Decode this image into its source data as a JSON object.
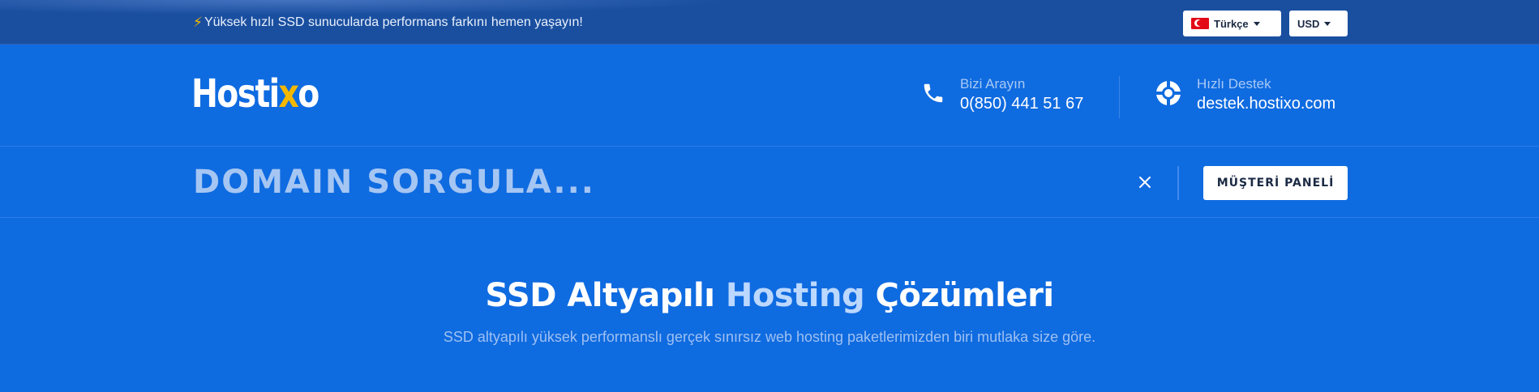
{
  "topbar": {
    "promo_icon": "lightning-icon",
    "promo_text": "Yüksek hızlı SSD sunucularda performans farkını hemen yaşayın!",
    "language": {
      "flag": "turkey-flag",
      "label": "Türkçe"
    },
    "currency": {
      "label": "USD"
    }
  },
  "header": {
    "logo_text_pre": "Hosti",
    "logo_text_x": "x",
    "logo_text_post": "o",
    "phone": {
      "icon": "phone-icon",
      "label": "Bizi Arayın",
      "value": "0(850) 441 51 67"
    },
    "support": {
      "icon": "lifebuoy-icon",
      "label": "Hızlı Destek",
      "value": "destek.hostixo.com"
    }
  },
  "domain_search": {
    "placeholder": "DOMAIN SORGULA...",
    "close_icon": "close-icon",
    "panel_button": "MÜŞTERİ PANELİ"
  },
  "hero": {
    "title_part1": "SSD Altyapılı ",
    "title_accent": "Hosting",
    "title_part2": " Çözümleri",
    "subtitle": "SSD altyapılı yüksek performanslı gerçek sınırsız web hosting paketlerimizden biri mutlaka size göre."
  },
  "colors": {
    "background": "#0f6be0",
    "topbar": "#1a4fa0",
    "accent_yellow": "#f5b800"
  }
}
